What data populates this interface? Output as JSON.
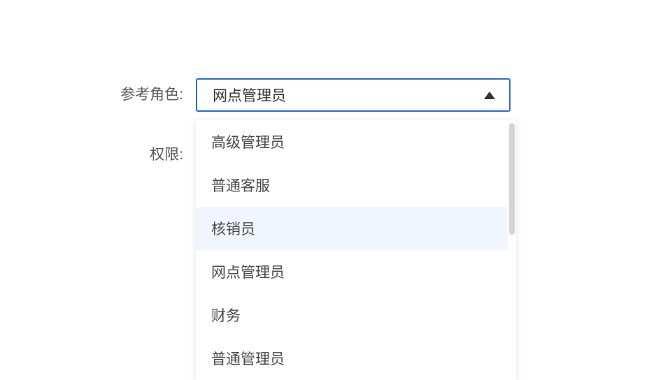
{
  "form": {
    "role_label": "参考角色:",
    "permission_label": "权限:",
    "selected_role": "网点管理员"
  },
  "dropdown": {
    "options": [
      {
        "label": "高级管理员",
        "highlighted": false
      },
      {
        "label": "普通客服",
        "highlighted": false
      },
      {
        "label": "核销员",
        "highlighted": true
      },
      {
        "label": "网点管理员",
        "highlighted": false
      },
      {
        "label": "财务",
        "highlighted": false
      },
      {
        "label": "普通管理员",
        "highlighted": false
      }
    ]
  }
}
